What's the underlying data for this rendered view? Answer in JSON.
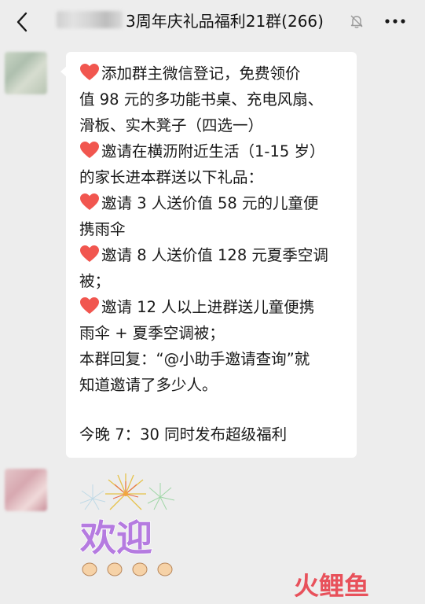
{
  "header": {
    "title": "3周年庆礼品福利21群(266)",
    "icons": {
      "back": "chevron-left-icon",
      "mute": "bell-off-icon",
      "more": "more-dots-icon"
    }
  },
  "message": {
    "lines": [
      "添加群主微信登记，免费领价",
      "值 98 元的多功能书桌、充电风扇、",
      "滑板、实木凳子（四选一）",
      "邀请在横沥附近生活（1-15 岁）",
      "的家长进本群送以下礼品：",
      "邀请 3 人送价值 58 元的儿童便",
      "携雨伞",
      "邀请 8 人送价值 128 元夏季空调",
      "被；",
      "邀请 12 人以上进群送儿童便携",
      "雨伞 + 夏季空调被；",
      "本群回复：“@小助手邀请查询”就",
      "知道邀请了多少人。",
      "",
      "今晚 7：30 同时发布超级福利"
    ],
    "heart_icon": "red-heart-icon"
  },
  "sticker": {
    "text": "欢迎",
    "icons": [
      "fireworks-icon",
      "clapping-hands-icon"
    ]
  },
  "watermark": {
    "text": "火鲤鱼"
  }
}
